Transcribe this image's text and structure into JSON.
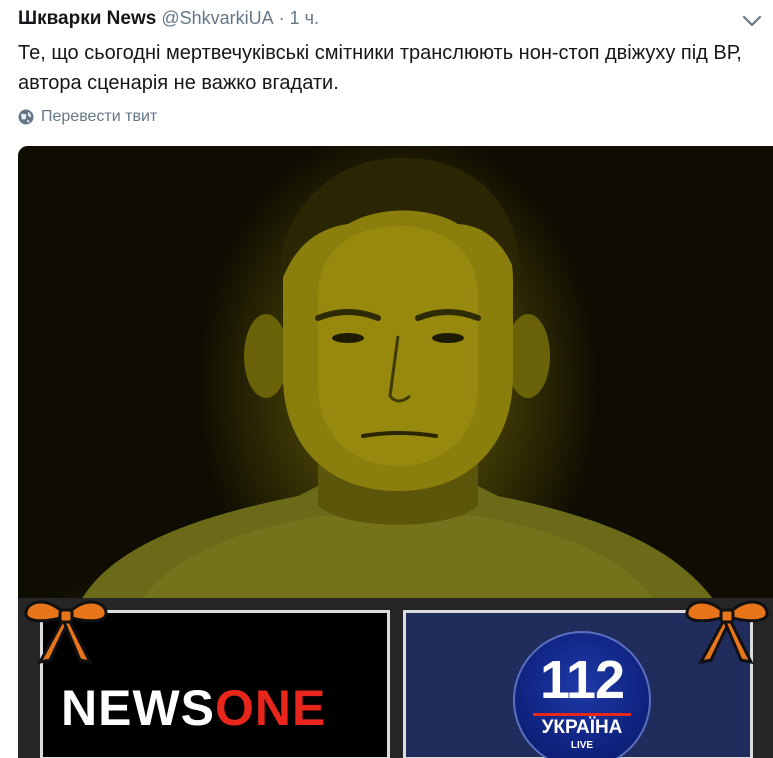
{
  "tweet": {
    "display_name": "Шкварки News",
    "handle": "@ShkvarkiUA",
    "separator": "·",
    "time": "1 ч.",
    "text": "Те, що сьогодні мертвечуківські смітники транслюють нон-стоп двіжуху під ВР, автора сценарія не важко вгадати.",
    "translate_label": "Перевести твит"
  },
  "media": {
    "left_logo": {
      "part1": "NEWS",
      "part2": "ONE",
      "colors": {
        "part1": "#ffffff",
        "part2": "#e8261c"
      }
    },
    "right_logo": {
      "number": "112",
      "country": "УКРАЇНА",
      "tag": "LIVE"
    }
  },
  "colors": {
    "text": "#14171a",
    "secondary": "#657786",
    "photo_tint": "#6e6708",
    "ribbon_orange": "#e8751a",
    "ribbon_black": "#111111"
  },
  "icons": {
    "caret": "chevron-down-icon",
    "translate": "globe-icon",
    "ribbon": "st-george-ribbon-icon"
  }
}
